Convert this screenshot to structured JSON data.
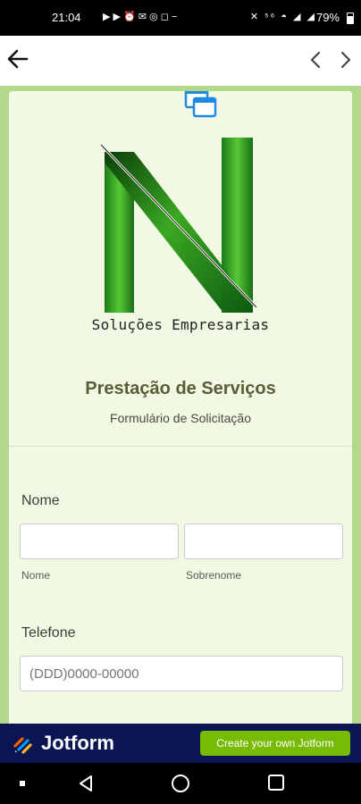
{
  "status_bar": {
    "time": "21:04",
    "left_icons": "▶ ▶ ⏰ ✉ ◎ ◻ −",
    "right_icons": "✕ ⁵⁶ ◓ ◢ ◢",
    "battery": "79%"
  },
  "form": {
    "brand": "Soluções Empresarias",
    "title": "Prestação de Serviços",
    "subtitle": "Formulário de Solicitação",
    "nome": {
      "label": "Nome",
      "first_sublabel": "Nome",
      "last_sublabel": "Sobrenome",
      "first_value": "",
      "last_value": ""
    },
    "telefone": {
      "label": "Telefone",
      "placeholder": "(DDD)0000-00000",
      "value": ""
    }
  },
  "jotform": {
    "name": "Jotform",
    "cta": "Create your own Jotform"
  },
  "colors": {
    "jotform_bar": "#0a1551",
    "cta_green": "#78bb07",
    "form_background": "#f1f9e4",
    "page_border": "#b2d98a",
    "title": "#5c5c36"
  }
}
